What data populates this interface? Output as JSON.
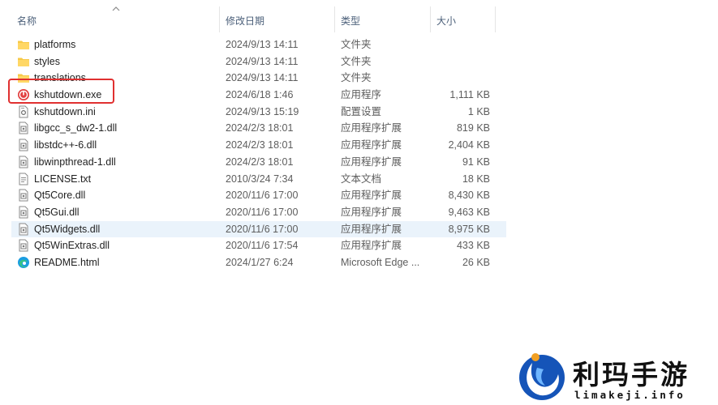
{
  "columns": {
    "name": "名称",
    "date": "修改日期",
    "type": "类型",
    "size": "大小"
  },
  "files": [
    {
      "name": "platforms",
      "date": "2024/9/13 14:11",
      "type": "文件夹",
      "size": "",
      "icon": "folder-icon"
    },
    {
      "name": "styles",
      "date": "2024/9/13 14:11",
      "type": "文件夹",
      "size": "",
      "icon": "folder-icon"
    },
    {
      "name": "translations",
      "date": "2024/9/13 14:11",
      "type": "文件夹",
      "size": "",
      "icon": "folder-icon"
    },
    {
      "name": "kshutdown.exe",
      "date": "2024/6/18 1:46",
      "type": "应用程序",
      "size": "1,111 KB",
      "icon": "kshutdown-app-icon"
    },
    {
      "name": "kshutdown.ini",
      "date": "2024/9/13 15:19",
      "type": "配置设置",
      "size": "1 KB",
      "icon": "settings-file-icon"
    },
    {
      "name": "libgcc_s_dw2-1.dll",
      "date": "2024/2/3 18:01",
      "type": "应用程序扩展",
      "size": "819 KB",
      "icon": "dll-file-icon"
    },
    {
      "name": "libstdc++-6.dll",
      "date": "2024/2/3 18:01",
      "type": "应用程序扩展",
      "size": "2,404 KB",
      "icon": "dll-file-icon"
    },
    {
      "name": "libwinpthread-1.dll",
      "date": "2024/2/3 18:01",
      "type": "应用程序扩展",
      "size": "91 KB",
      "icon": "dll-file-icon"
    },
    {
      "name": "LICENSE.txt",
      "date": "2010/3/24 7:34",
      "type": "文本文档",
      "size": "18 KB",
      "icon": "text-file-icon"
    },
    {
      "name": "Qt5Core.dll",
      "date": "2020/11/6 17:00",
      "type": "应用程序扩展",
      "size": "8,430 KB",
      "icon": "dll-file-icon"
    },
    {
      "name": "Qt5Gui.dll",
      "date": "2020/11/6 17:00",
      "type": "应用程序扩展",
      "size": "9,463 KB",
      "icon": "dll-file-icon"
    },
    {
      "name": "Qt5Widgets.dll",
      "date": "2020/11/6 17:00",
      "type": "应用程序扩展",
      "size": "8,975 KB",
      "icon": "dll-file-icon",
      "selected": true
    },
    {
      "name": "Qt5WinExtras.dll",
      "date": "2020/11/6 17:54",
      "type": "应用程序扩展",
      "size": "433 KB",
      "icon": "dll-file-icon"
    },
    {
      "name": "README.html",
      "date": "2024/1/27 6:24",
      "type": "Microsoft Edge ...",
      "size": "26 KB",
      "icon": "edge-browser-icon"
    }
  ],
  "watermark": {
    "title": "利玛手游",
    "subtitle": "limakeji.info"
  },
  "colors": {
    "selected_row": "#eaf3fb",
    "highlight_box": "#e03030",
    "folder": "#f7c948"
  }
}
